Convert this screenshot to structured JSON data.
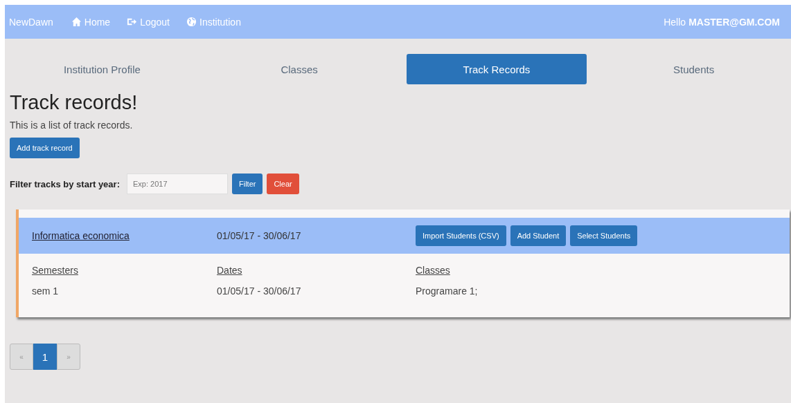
{
  "navbar": {
    "brand": "NewDawn",
    "links": [
      {
        "kind": "home",
        "label": "Home"
      },
      {
        "kind": "logout",
        "label": "Logout"
      },
      {
        "kind": "globe",
        "label": "Institution"
      }
    ],
    "greeting": "Hello",
    "user": "MASTER@GM.COM"
  },
  "tabs": [
    {
      "label": "Institution Profile",
      "selected": false
    },
    {
      "label": "Classes",
      "selected": false
    },
    {
      "label": "Track Records",
      "selected": true
    },
    {
      "label": "Students",
      "selected": false
    }
  ],
  "heading": "Track records!",
  "subtitle": "This is a list of track records.",
  "add_button": "Add track record",
  "filter": {
    "label": "Filter tracks by start year:",
    "placeholder": "Exp: 2017",
    "buttons": [
      {
        "kind": "primary",
        "label": "Filter"
      },
      {
        "kind": "danger",
        "label": "Clear"
      }
    ]
  },
  "tracks": [
    {
      "name": "Informatica economica",
      "dates": "01/05/17 - 30/06/17",
      "actions": [
        "Import Students (CSV)",
        "Add Student",
        "Select Students"
      ],
      "columns": [
        {
          "heading": "Semesters",
          "value": "sem 1"
        },
        {
          "heading": "Dates",
          "value": "01/05/17 - 30/06/17"
        },
        {
          "heading": "Classes",
          "value": "Programare 1;"
        }
      ]
    }
  ],
  "pagination": {
    "prev": "«",
    "pages": [
      {
        "label": "1",
        "selected": true
      }
    ],
    "next": "»"
  }
}
